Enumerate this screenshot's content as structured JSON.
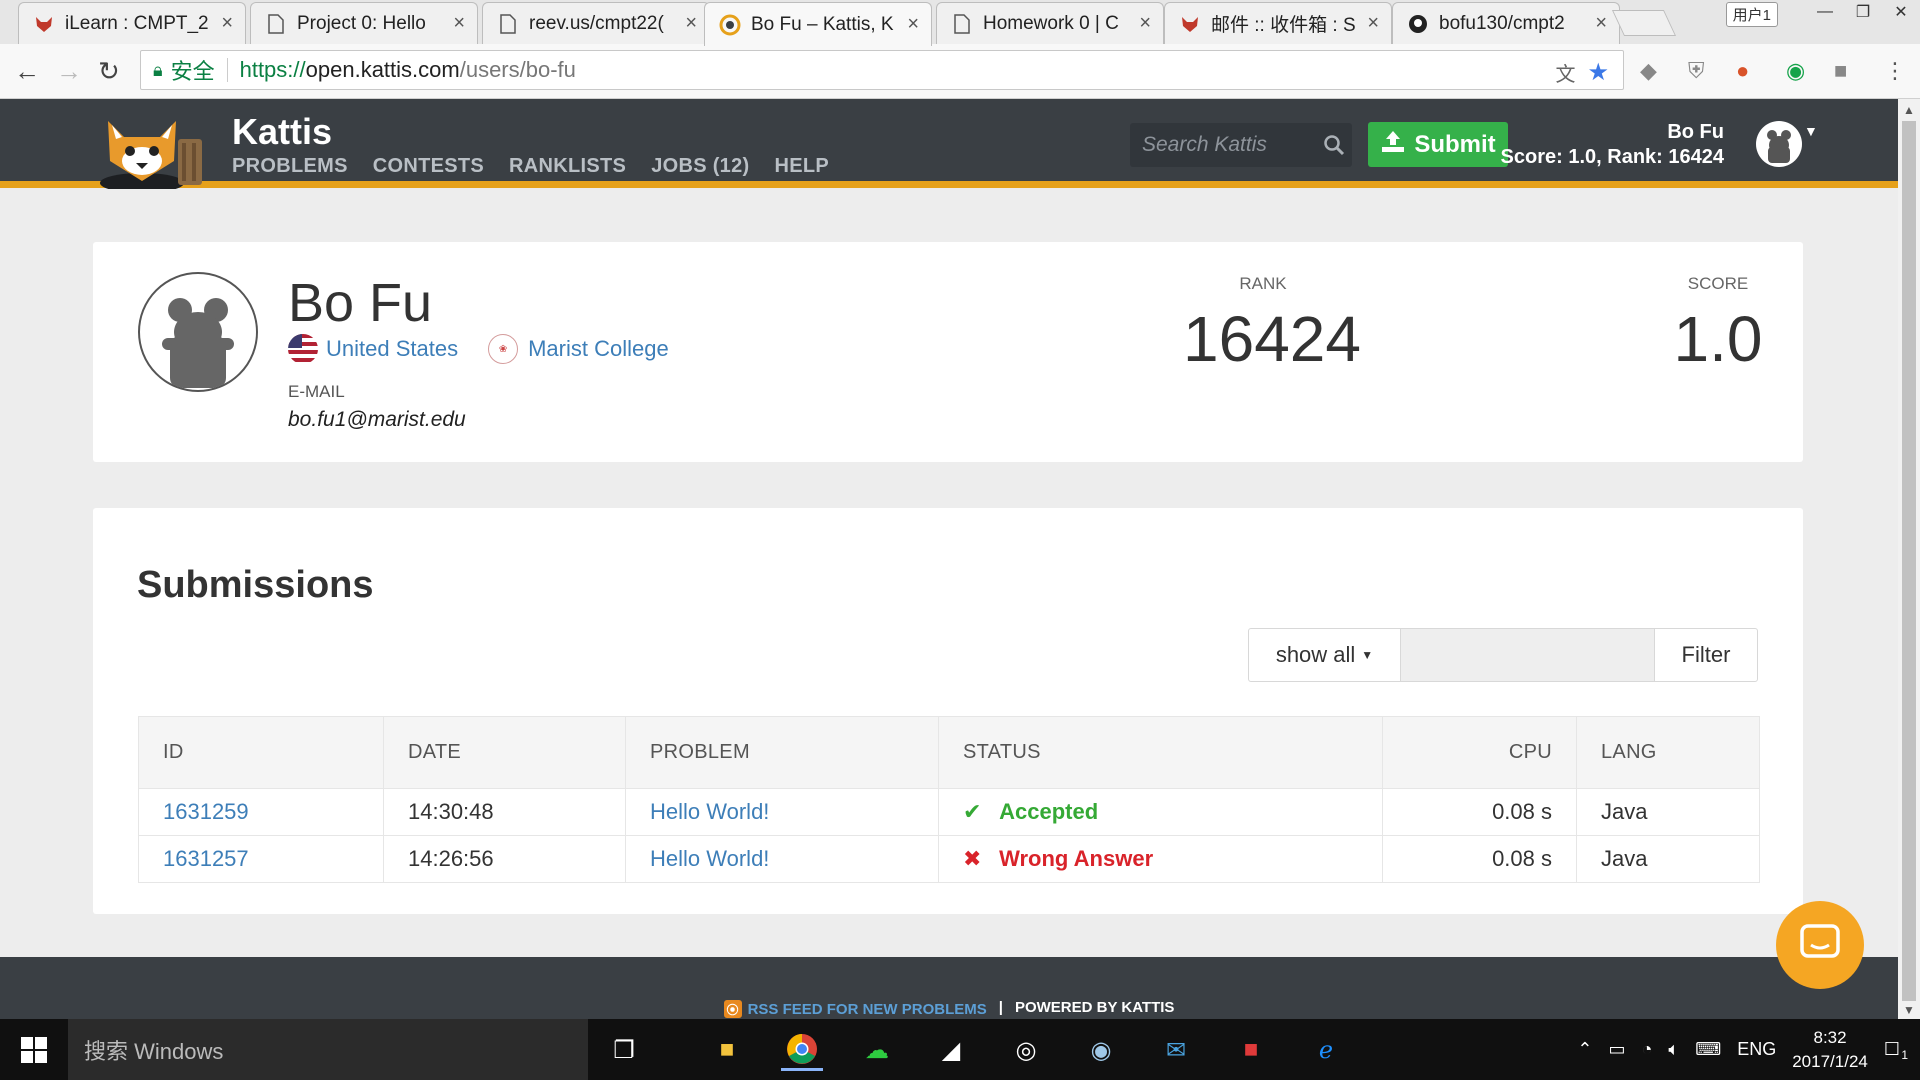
{
  "browser": {
    "tabs": [
      {
        "title": "iLearn : CMPT_2",
        "icon": "fox-icon"
      },
      {
        "title": "Project 0: Hello",
        "icon": "page-icon"
      },
      {
        "title": "reev.us/cmpt22(",
        "icon": "page-icon"
      },
      {
        "title": "Bo Fu – Kattis, K",
        "icon": "kattis-icon"
      },
      {
        "title": "Homework 0 | C",
        "icon": "page-icon"
      },
      {
        "title": "邮件 :: 收件箱 : S",
        "icon": "fox-icon"
      },
      {
        "title": "bofu130/cmpt2",
        "icon": "github-icon"
      }
    ],
    "user_button": "用户1",
    "address": {
      "secure_label": "安全",
      "scheme": "https://",
      "host": "open.kattis.com",
      "path": "/users/bo-fu"
    }
  },
  "site": {
    "brand": "Kattis",
    "nav": [
      "PROBLEMS",
      "CONTESTS",
      "RANKLISTS",
      "JOBS (12)",
      "HELP"
    ],
    "search_placeholder": "Search Kattis",
    "submit_label": "Submit",
    "user_name": "Bo Fu",
    "user_score_rank": "Score: 1.0, Rank: 16424"
  },
  "profile": {
    "name": "Bo Fu",
    "country": "United States",
    "school": "Marist College",
    "email_label": "E-MAIL",
    "email": "bo.fu1@marist.edu",
    "rank_label": "RANK",
    "rank": "16424",
    "score_label": "SCORE",
    "score": "1.0"
  },
  "submissions": {
    "title": "Submissions",
    "filter_dropdown": "show all",
    "filter_button": "Filter",
    "columns": [
      "ID",
      "DATE",
      "PROBLEM",
      "STATUS",
      "CPU",
      "LANG"
    ],
    "rows": [
      {
        "id": "1631259",
        "date": "14:30:48",
        "problem": "Hello World!",
        "status": "Accepted",
        "status_mark": "✔",
        "cpu": "0.08 s",
        "lang": "Java"
      },
      {
        "id": "1631257",
        "date": "14:26:56",
        "problem": "Hello World!",
        "status": "Wrong Answer",
        "status_mark": "✖",
        "cpu": "0.08 s",
        "lang": "Java"
      }
    ]
  },
  "footer": {
    "rss": "RSS FEED FOR NEW PROBLEMS",
    "separator": "|",
    "powered": "POWERED BY KATTIS"
  },
  "taskbar": {
    "search_placeholder": "搜索 Windows",
    "language": "ENG",
    "time": "8:32",
    "date": "2017/1/24",
    "notifications": "1"
  },
  "colors": {
    "accent_orange": "#e6a11b",
    "header_bg": "#3a3f44",
    "submit_green": "#35b14a",
    "link_blue": "#3d7eb8",
    "accepted": "#35a935",
    "wrong": "#d9232a"
  }
}
